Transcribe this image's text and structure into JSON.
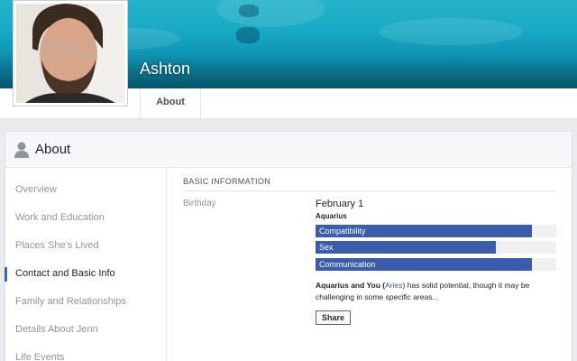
{
  "profile": {
    "name": "Ashton"
  },
  "tabs": {
    "about_label": "About"
  },
  "about": {
    "header_title": "About",
    "nav": [
      {
        "label": "Overview",
        "active": false
      },
      {
        "label": "Work and Education",
        "active": false
      },
      {
        "label": "Places She's Lived",
        "active": false
      },
      {
        "label": "Contact and Basic Info",
        "active": true
      },
      {
        "label": "Family and Relationships",
        "active": false
      },
      {
        "label": "Details About Jenn",
        "active": false
      },
      {
        "label": "Life Events",
        "active": false
      }
    ],
    "basic_info": {
      "section_title": "BASIC INFORMATION",
      "birthday_label": "Birthday",
      "birthday_value": "February 1",
      "zodiac_sign": "Aquarius",
      "bars": [
        {
          "label": "Compatibility",
          "fraction": 0.9
        },
        {
          "label": "Sex",
          "fraction": 0.75
        },
        {
          "label": "Communication",
          "fraction": 0.9
        }
      ],
      "description_prefix": "Aquarius and You (",
      "description_link": "Aries",
      "description_suffix": ") has solid potential, though it may be challenging in some specific areas...",
      "share_label": "Share"
    }
  },
  "colors": {
    "accent": "#3b5bab",
    "link": "#365899",
    "cover": "#18a9c4"
  },
  "icons": {
    "header": "person-icon"
  }
}
